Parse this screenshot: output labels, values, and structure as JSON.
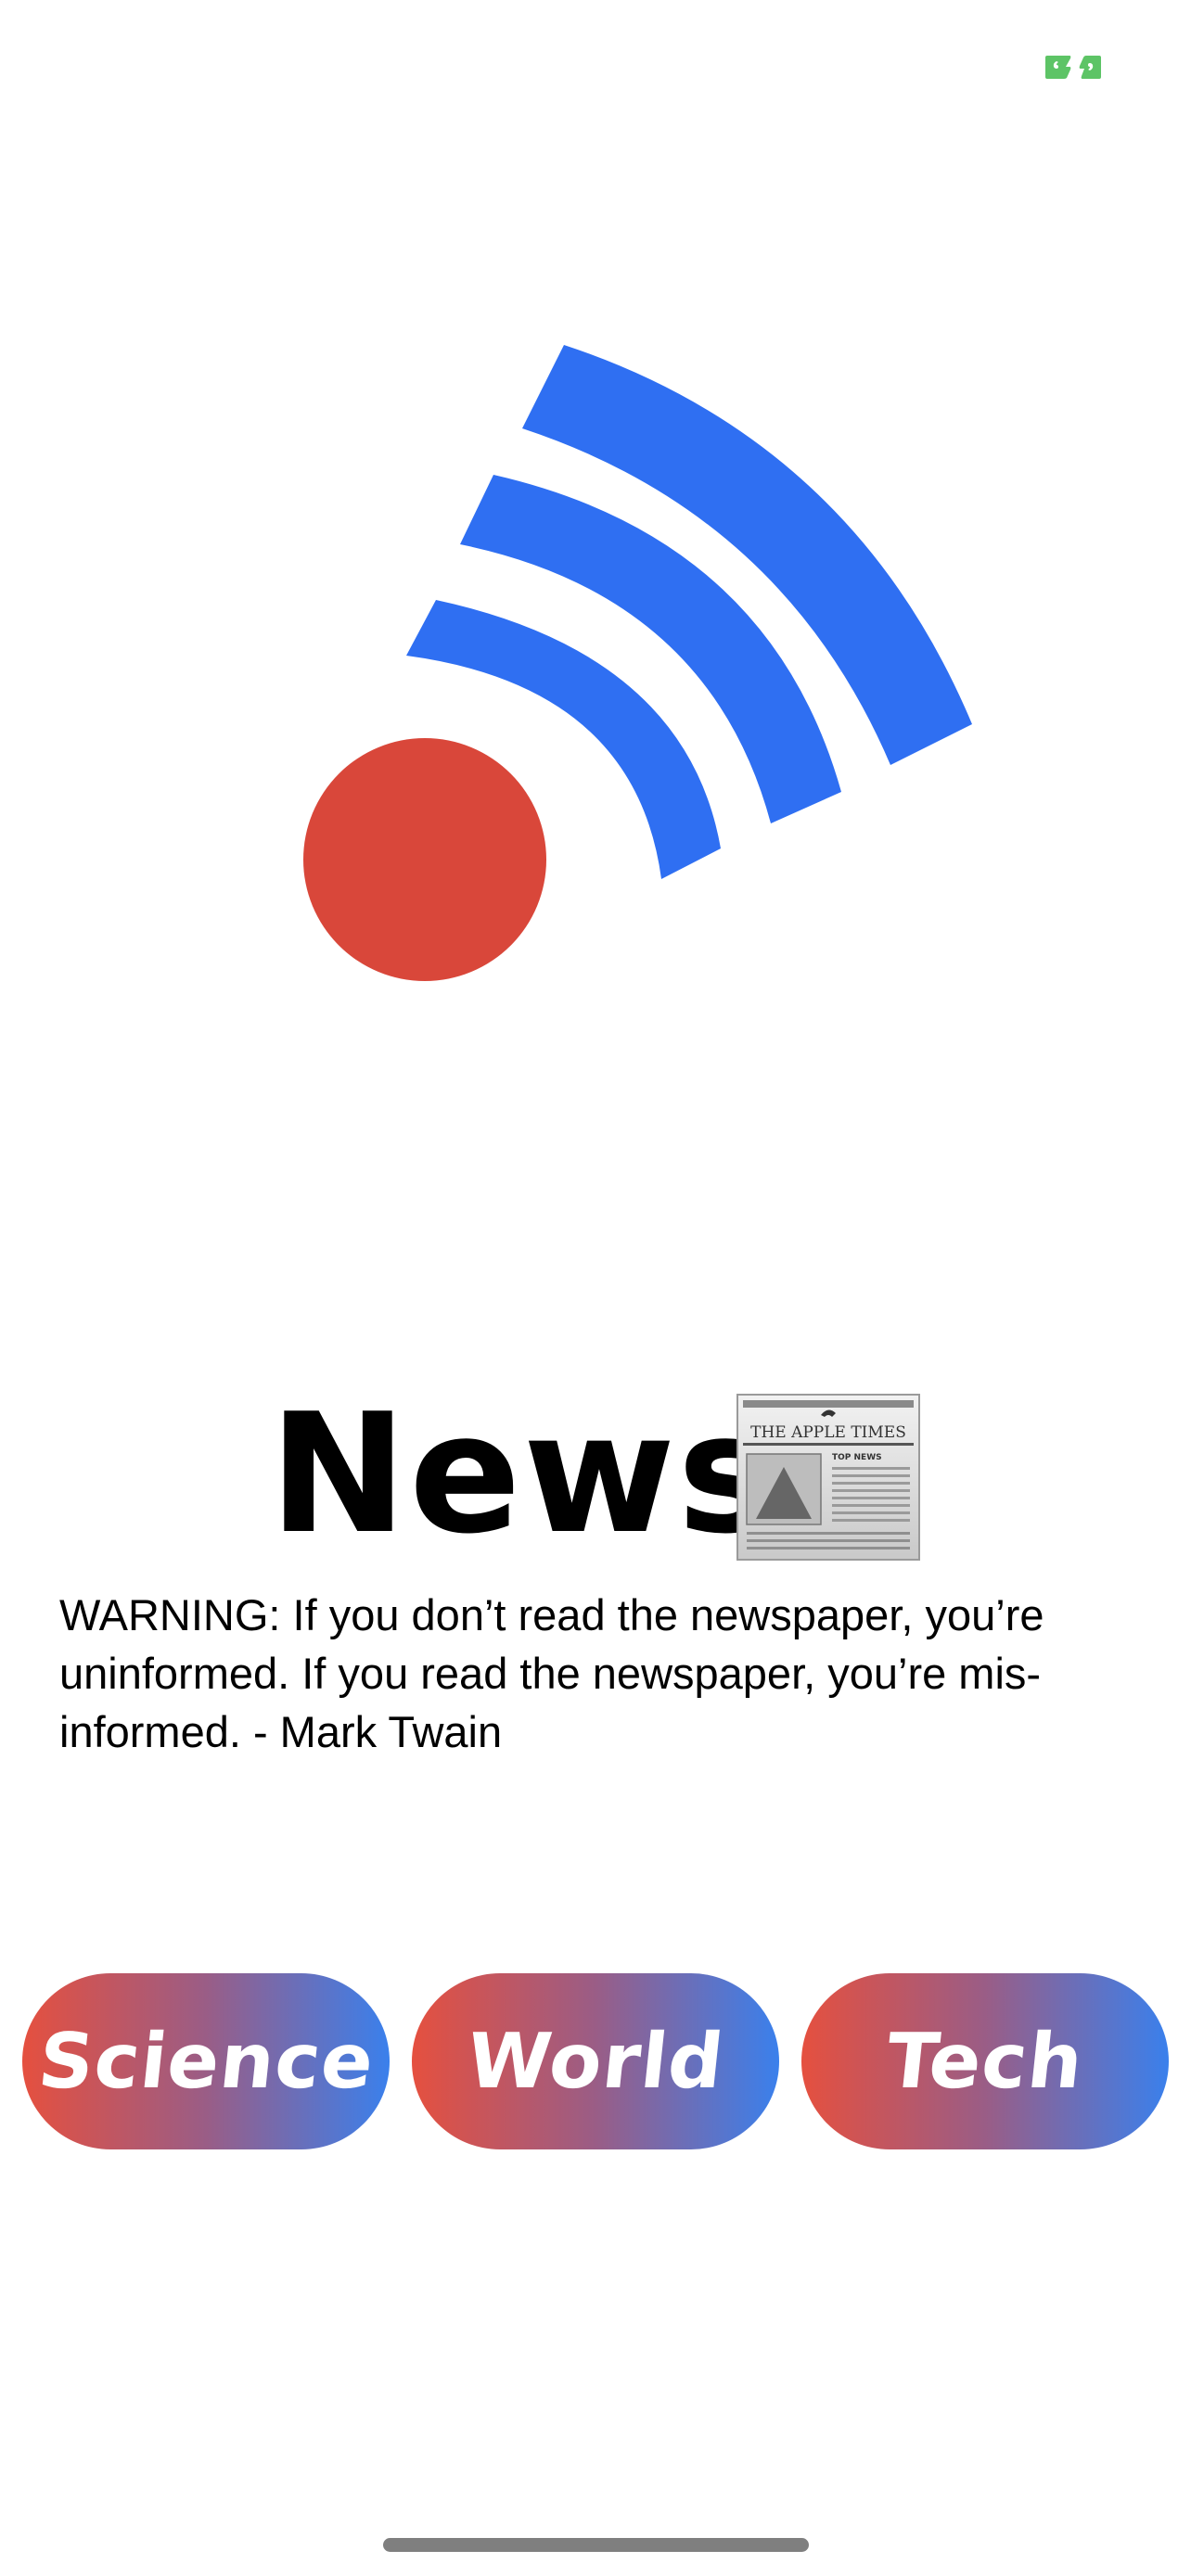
{
  "header": {
    "quote_button_icon": "quote-bubble-icon",
    "quote_button_color": "#5dc466"
  },
  "logo": {
    "icon": "news-feed-logo-icon",
    "dot_color": "#d9473a",
    "wave_color": "#2f6ff2"
  },
  "title": {
    "text": "News",
    "emoji_icon": "newspaper-icon",
    "newspaper_masthead": "THE APPLE TIMES",
    "newspaper_section": "TOP NEWS"
  },
  "quote": {
    "text": "WARNING: If you don’t read the newspaper, you’re uninformed. If you read the newspaper, you’re mis-informed. - Mark Twain"
  },
  "categories": [
    {
      "label": "Science"
    },
    {
      "label": "World"
    },
    {
      "label": "Tech"
    }
  ],
  "colors": {
    "button_gradient_start": "#e5503f",
    "button_gradient_end": "#3a80ec",
    "text": "#000000",
    "background": "#ffffff"
  }
}
